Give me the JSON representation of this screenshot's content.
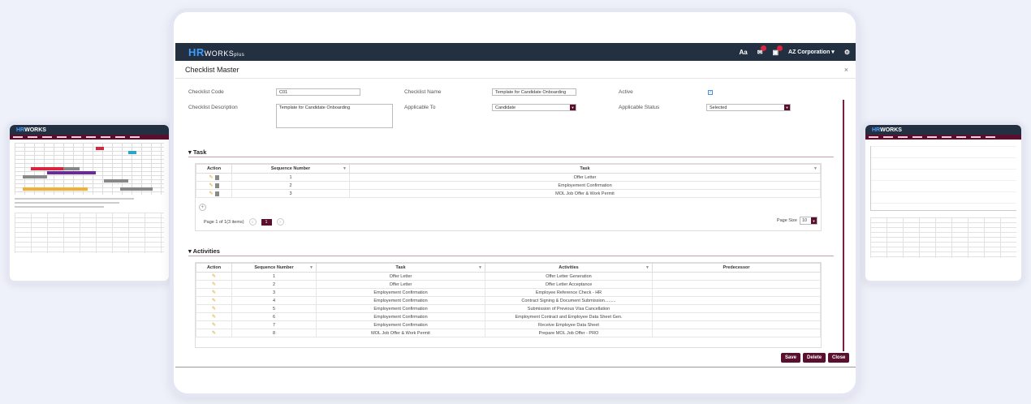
{
  "app": {
    "logo_hr": "HR",
    "logo_works": "WORKS",
    "logo_plus": "plus",
    "font_icon": "Aa",
    "notif_count_1": "",
    "notif_count_2": "",
    "company": "AZ Corporation ▾",
    "settings_icon": "gear-icon"
  },
  "dialog": {
    "title": "Checklist Master",
    "close": "×"
  },
  "form": {
    "checklist_code_label": "Checklist Code",
    "checklist_code_value": "C01",
    "checklist_name_label": "Checklist Name",
    "checklist_name_value": "Template for Candidate Onboarding",
    "active_label": "Active",
    "active_checked": "✓",
    "checklist_desc_label": "Checklist Description",
    "checklist_desc_value": "Template for Candidate Onboarding",
    "applicable_to_label": "Applicable To",
    "applicable_to_value": "Candidate",
    "applicable_status_label": "Applicable Status",
    "applicable_status_value": "Selected"
  },
  "task_section": {
    "heading": "Task",
    "columns": [
      "Action",
      "Sequence Number",
      "Task"
    ],
    "rows": [
      {
        "seq": "1",
        "task": "Offer Letter"
      },
      {
        "seq": "2",
        "task": "Employement Confirmation"
      },
      {
        "seq": "3",
        "task": "MOL Job Offer & Work Permit"
      }
    ],
    "pager_text": "Page 1 of 1(3 items)",
    "current_page": "1",
    "page_size_label": "Page Size",
    "page_size_value": "10"
  },
  "activities_section": {
    "heading": "Activities",
    "columns": [
      "Action",
      "Sequence Number",
      "Task",
      "Activities",
      "Predecessor"
    ],
    "rows": [
      {
        "seq": "1",
        "task": "Offer Letter",
        "activity": "Offer Letter Generation",
        "pred": ""
      },
      {
        "seq": "2",
        "task": "Offer Letter",
        "activity": "Offer Letter Acceptance",
        "pred": ""
      },
      {
        "seq": "3",
        "task": "Employement Confirmation",
        "activity": "Employee Reference Check - HR",
        "pred": ""
      },
      {
        "seq": "4",
        "task": "Employement Confirmation",
        "activity": "Contract Signing & Document Submission.........",
        "pred": ""
      },
      {
        "seq": "5",
        "task": "Employement Confirmation",
        "activity": "Submission of Previous Visa Cancellation",
        "pred": ""
      },
      {
        "seq": "6",
        "task": "Employement Confirmation",
        "activity": "Employment Contract and Employee Data Sheet Gen.",
        "pred": ""
      },
      {
        "seq": "7",
        "task": "Employement Confirmation",
        "activity": "Receive Employee Data Sheet",
        "pred": ""
      },
      {
        "seq": "8",
        "task": "MOL Job Offer & Work Permit",
        "activity": "Prepare MOL Job Offer - PRO",
        "pred": ""
      }
    ]
  },
  "buttons": {
    "save": "Save",
    "delete": "Delete",
    "close": "Close"
  },
  "colors": {
    "brand_dark": "#233041",
    "accent_maroon": "#5a0f2e",
    "logo_blue": "#3d9bff"
  }
}
